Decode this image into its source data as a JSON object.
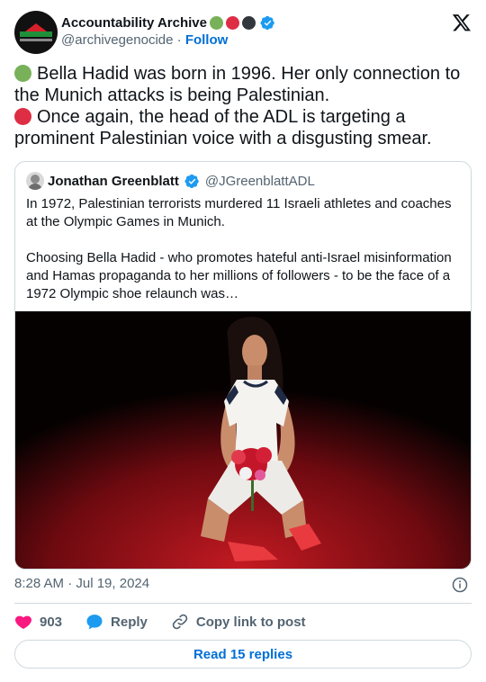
{
  "author": {
    "name": "Accountability Archive",
    "handle": "@archivegenocide",
    "separator": "·",
    "follow_label": "Follow",
    "name_emojis": [
      "green-circle",
      "red-circle",
      "black-circle"
    ],
    "avatar_icon": "accountability-archive-logo"
  },
  "tweet": {
    "lines": [
      {
        "emoji": "green-circle",
        "text": "Bella Hadid was born in 1996. Her only connection to the Munich attacks is being Palestinian."
      },
      {
        "emoji": "red-circle",
        "text": "Once again, the head of the ADL is targeting a prominent Palestinian voice with a disgusting smear."
      }
    ]
  },
  "quote": {
    "name": "Jonathan Greenblatt",
    "handle": "@JGreenblattADL",
    "paragraphs": [
      "In 1972, Palestinian terrorists murdered 11 Israeli athletes and coaches at the Olympic Games in Munich.",
      "Choosing Bella Hadid - who promotes hateful anti-Israel misinformation and Hamas propaganda to her millions of followers - to be the face of a 1972 Olympic shoe relaunch was…"
    ]
  },
  "footer": {
    "timestamp": "8:28 AM · Jul 19, 2024",
    "like_count": "903",
    "reply_label": "Reply",
    "copy_label": "Copy link to post",
    "read_replies_label": "Read 15 replies"
  },
  "colors": {
    "accent": "#006fd6",
    "muted": "#536471",
    "like": "#f91880",
    "verified": "#1d9bf0",
    "border": "#cfd9de"
  }
}
